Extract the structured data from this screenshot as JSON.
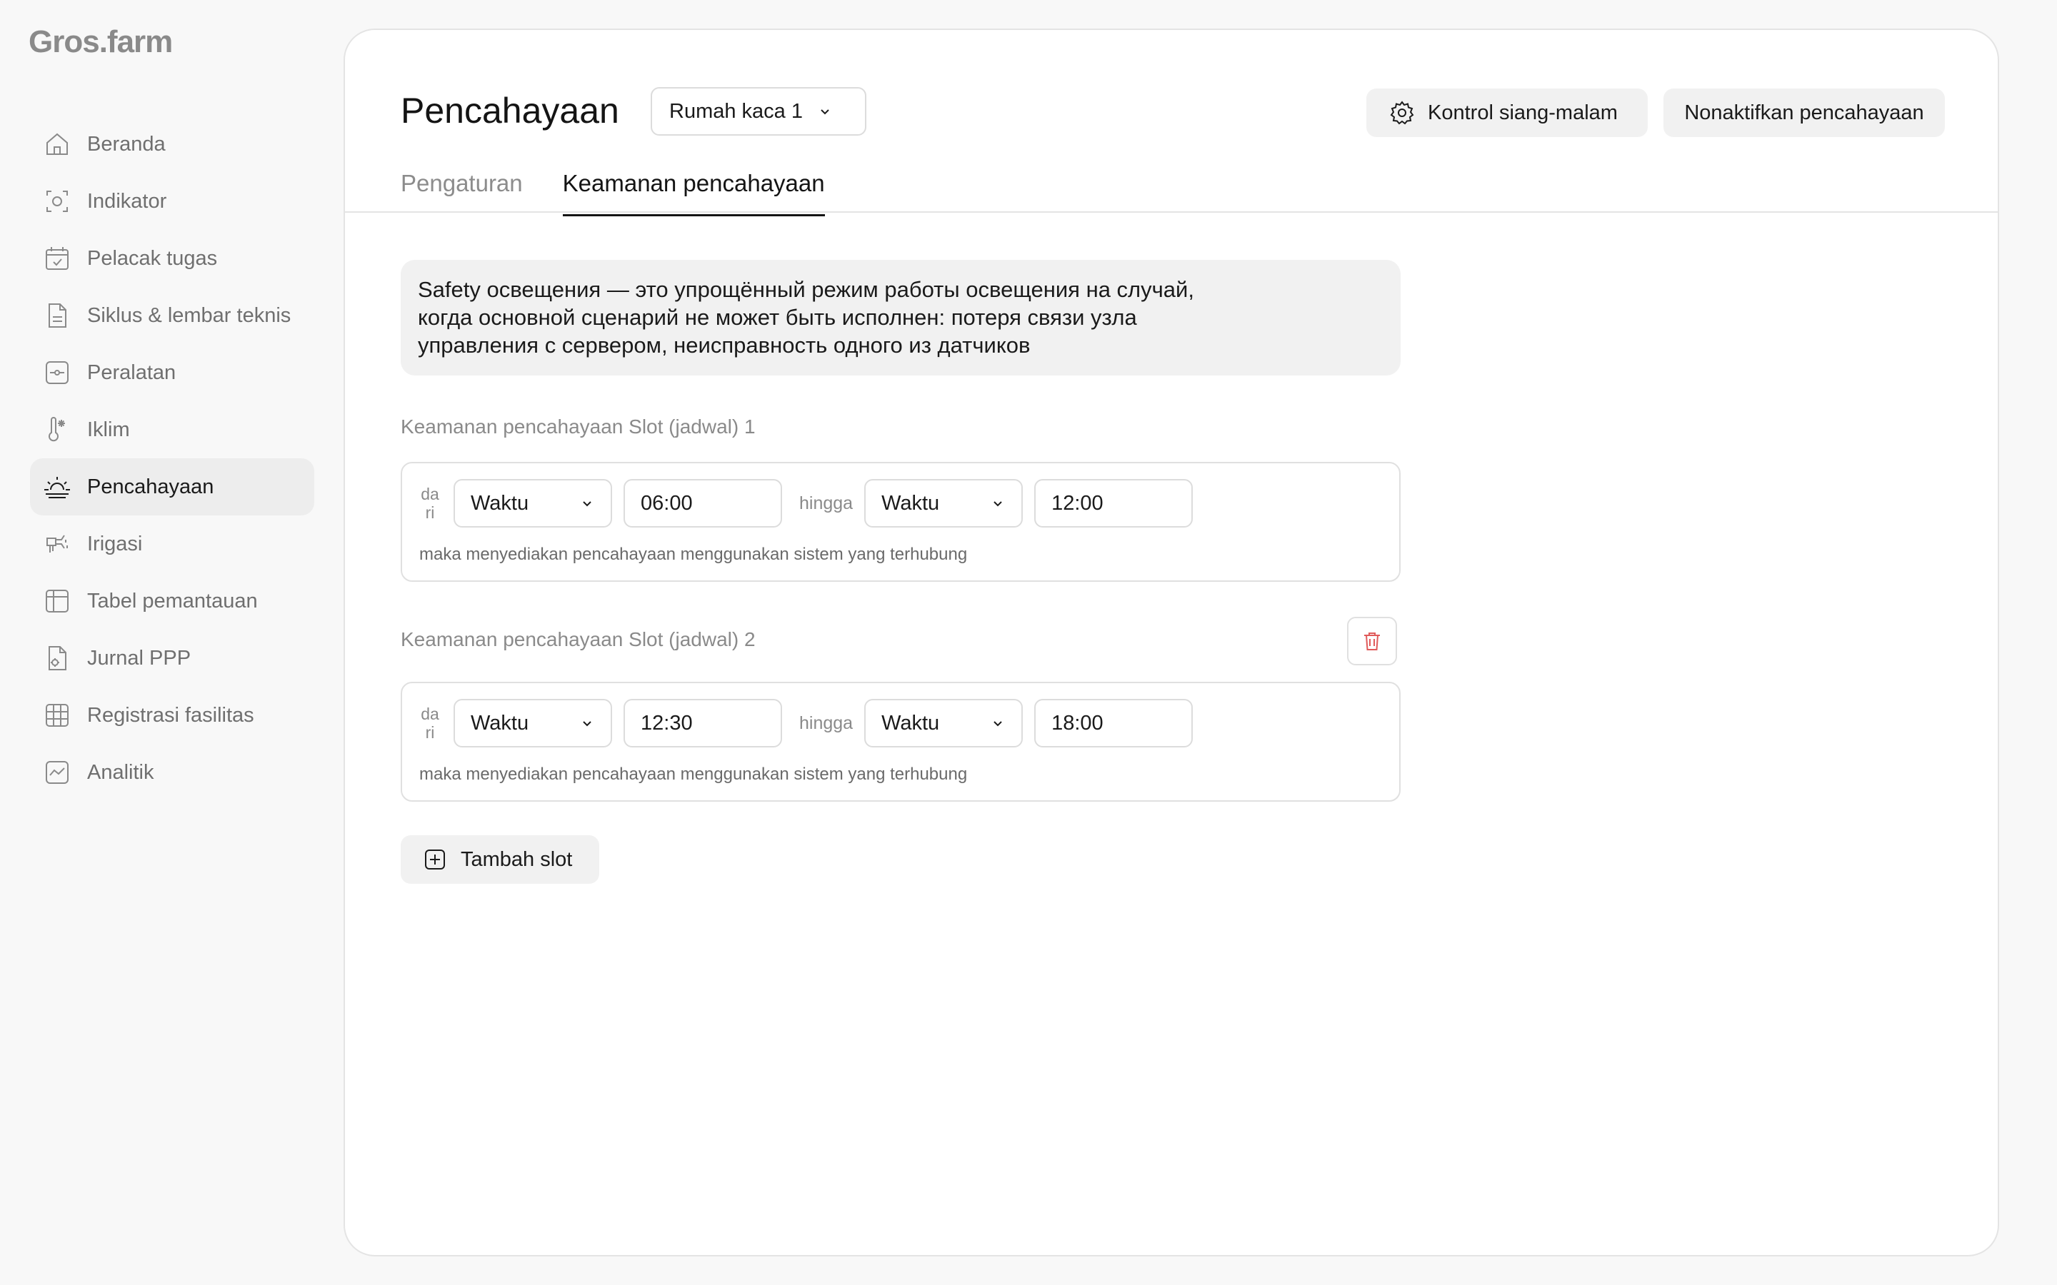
{
  "app": {
    "logo": "Gros.farm"
  },
  "sidebar": {
    "items": [
      {
        "label": "Beranda",
        "icon": "home-icon"
      },
      {
        "label": "Indikator",
        "icon": "indicator-icon"
      },
      {
        "label": "Pelacak tugas",
        "icon": "calendar-check-icon"
      },
      {
        "label": "Siklus & lembar teknis",
        "icon": "document-icon"
      },
      {
        "label": "Peralatan",
        "icon": "equipment-icon"
      },
      {
        "label": "Iklim",
        "icon": "thermometer-icon"
      },
      {
        "label": "Pencahayaan",
        "icon": "sunrise-icon",
        "active": true
      },
      {
        "label": "Irigasi",
        "icon": "irrigation-icon"
      },
      {
        "label": "Tabel pemantauan",
        "icon": "table-icon"
      },
      {
        "label": "Jurnal PPP",
        "icon": "journal-icon"
      },
      {
        "label": "Registrasi fasilitas",
        "icon": "grid-icon"
      },
      {
        "label": "Analitik",
        "icon": "analytics-icon"
      }
    ]
  },
  "header": {
    "title": "Pencahayaan",
    "greenhouse_select": "Rumah kaca 1",
    "daynight_button": "Kontrol siang-malam",
    "disable_button": "Nonaktifkan pencahayaan"
  },
  "tabs": [
    {
      "label": "Pengaturan",
      "active": false
    },
    {
      "label": "Keamanan pencahayaan",
      "active": true
    }
  ],
  "info": {
    "line1": "Safety освещения — это упрощённый режим работы освещения на случай,",
    "line2": "когда основной сценарий не может быть исполнен: потеря связи узла",
    "line3": "управления с сервером,  неисправность одного из датчиков"
  },
  "slots": [
    {
      "title": "Keamanan pencahayaan Slot (jadwal) 1",
      "from_label_1": "da",
      "from_label_2": "ri",
      "from_type": "Waktu",
      "from_time": "06:00",
      "to_label": "hingga",
      "to_type": "Waktu",
      "to_time": "12:00",
      "description": "maka menyediakan pencahayaan menggunakan sistem yang terhubung"
    },
    {
      "title": "Keamanan pencahayaan Slot (jadwal) 2",
      "from_label_1": "da",
      "from_label_2": "ri",
      "from_type": "Waktu",
      "from_time": "12:30",
      "to_label": "hingga",
      "to_type": "Waktu",
      "to_time": "18:00",
      "description": "maka menyediakan pencahayaan menggunakan sistem yang terhubung"
    }
  ],
  "add_slot_label": "Tambah slot",
  "colors": {
    "background": "#f8f8f8",
    "panel": "#ffffff",
    "active_nav": "#ededed",
    "delete": "#e05a5a"
  }
}
